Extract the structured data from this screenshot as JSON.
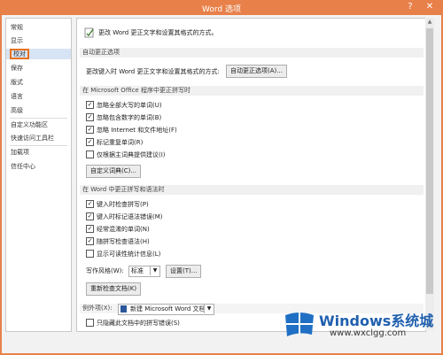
{
  "window": {
    "title": "Word 选项",
    "help_label": "?",
    "close_label": "✕"
  },
  "sidebar": {
    "items": [
      {
        "label": "常规"
      },
      {
        "label": "显示"
      },
      {
        "label": "校对"
      },
      {
        "label": "保存"
      },
      {
        "label": "版式"
      },
      {
        "label": "语言"
      },
      {
        "label": "高级"
      },
      {
        "label": "自定义功能区"
      },
      {
        "label": "快速访问工具栏"
      },
      {
        "label": "加载项"
      },
      {
        "label": "信任中心"
      }
    ]
  },
  "header": {
    "text": "更改 Word 更正文字和设置其格式的方式。"
  },
  "autocorrect": {
    "section": "自动更正选项",
    "label": "更改键入时 Word 更正文字和设置其格式的方式:",
    "button": "自动更正选项(A)..."
  },
  "office_spelling": {
    "section": "在 Microsoft Office 程序中更正拼写时",
    "options": [
      {
        "label": "忽略全部大写的单词(U)",
        "checked": true
      },
      {
        "label": "忽略包含数字的单词(B)",
        "checked": true
      },
      {
        "label": "忽略 Internet 和文件地址(F)",
        "checked": true
      },
      {
        "label": "标记重复单词(R)",
        "checked": true
      },
      {
        "label": "仅根据主词典提供建议(I)",
        "checked": false
      }
    ],
    "dictionary_button": "自定义词典(C)..."
  },
  "word_grammar": {
    "section": "在 Word 中更正拼写和语法时",
    "options": [
      {
        "label": "键入时检查拼写(P)",
        "checked": true
      },
      {
        "label": "键入时标记语法错误(M)",
        "checked": true
      },
      {
        "label": "经常混淆的单词(N)",
        "checked": true
      },
      {
        "label": "随拼写检查语法(H)",
        "checked": true
      },
      {
        "label": "显示可读性统计信息(L)",
        "checked": false
      }
    ],
    "style_label": "写作风格(W):",
    "style_value": "标准",
    "settings_button": "设置(T)...",
    "recheck_button": "重新检查文档(K)"
  },
  "exceptions": {
    "label": "例外项(X):",
    "document": "新建 Microsoft Word 文档",
    "option": {
      "label": "只隐藏此文档中的拼写错误(S)",
      "checked": false
    }
  },
  "watermark": {
    "brand": "Windows系统城",
    "url": "www.wxclgg.com"
  },
  "colors": {
    "accent": "#e8804a",
    "highlight": "#e8711c",
    "selected_bg": "#d7e4f5"
  }
}
